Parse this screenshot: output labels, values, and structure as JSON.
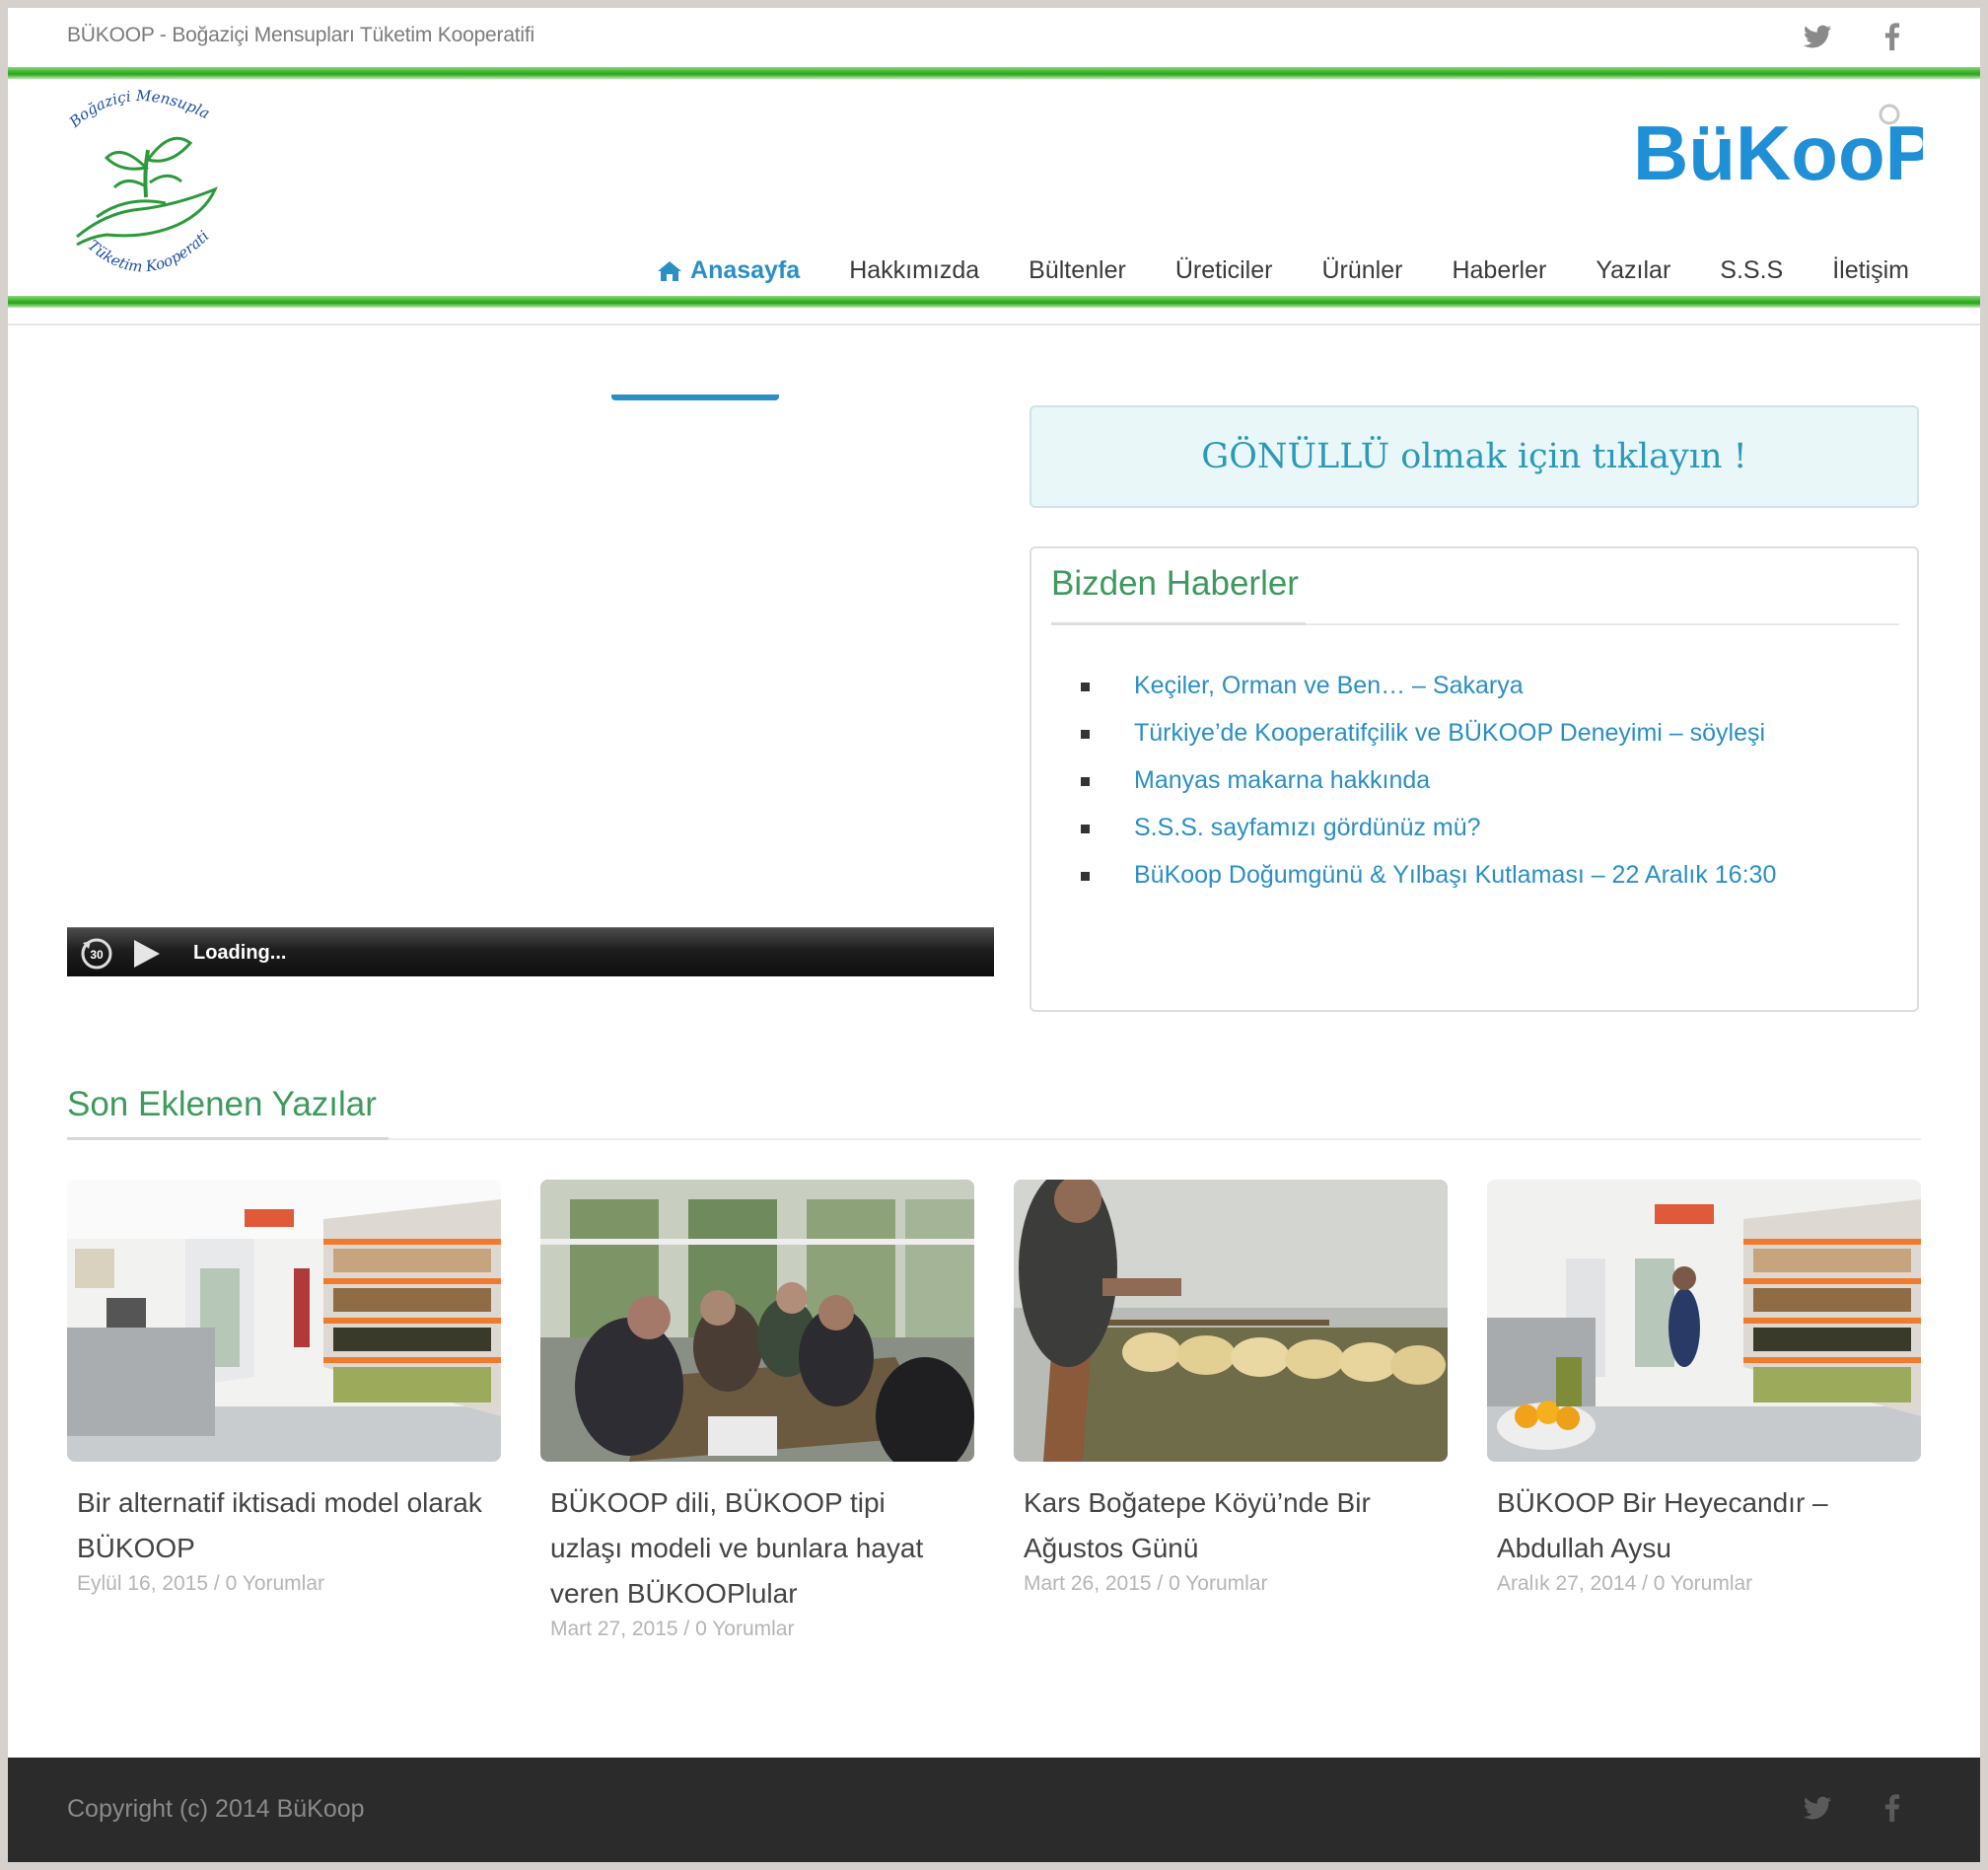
{
  "topbar": {
    "site_title": "BÜKOOP - Boğaziçi Mensupları Tüketim Kooperatifi",
    "social": [
      "twitter-icon",
      "facebook-icon"
    ]
  },
  "header": {
    "logo_text_top": "Boğaziçi Mensupları",
    "logo_text_bottom": "Tüketim Kooperatifi",
    "brand_text": "BüKooP",
    "brand_color": "#1f8fd6",
    "nav": [
      {
        "label": "Anasayfa",
        "active": true
      },
      {
        "label": "Hakkımızda"
      },
      {
        "label": "Bültenler"
      },
      {
        "label": "Üreticiler"
      },
      {
        "label": "Ürünler"
      },
      {
        "label": "Haberler"
      },
      {
        "label": "Yazılar"
      },
      {
        "label": "S.S.S"
      },
      {
        "label": "İletişim"
      }
    ]
  },
  "player": {
    "status": "Loading...",
    "rewind_label": "30"
  },
  "sidebar": {
    "volunteer_cta": "GÖNÜLLÜ olmak için tıklayın !",
    "news": {
      "title": "Bizden Haberler",
      "items": [
        "Keçiler, Orman ve Ben… – Sakarya",
        "Türkiye’de Kooperatifçilik ve BÜKOOP Deneyimi – söyleşi",
        "Manyas makarna hakkında",
        "S.S.S. sayfamızı gördünüz mü?",
        "BüKoop Doğumgünü & Yılbaşı Kutlaması – 22 Aralık 16:30"
      ]
    }
  },
  "recent": {
    "title": "Son Eklenen Yazılar",
    "posts": [
      {
        "title": "Bir alternatif iktisadi model olarak BÜKOOP",
        "meta": "Eylül 16, 2015 / 0 Yorumlar"
      },
      {
        "title": "BÜKOOP dili, BÜKOOP tipi uzlaşı modeli ve bunlara hayat veren BÜKOOPlular",
        "meta": "Mart 27, 2015 / 0 Yorumlar"
      },
      {
        "title": "Kars Boğatepe Köyü’nde Bir Ağustos Günü",
        "meta": "Mart 26, 2015 / 0 Yorumlar"
      },
      {
        "title": "BÜKOOP Bir Heyecandır – Abdullah Aysu",
        "meta": "Aralık 27, 2014 / 0 Yorumlar"
      }
    ]
  },
  "footer": {
    "copyright": "Copyright (c) 2014 BüKoop"
  },
  "colors": {
    "accent_green": "#3e9a5c",
    "link_blue": "#2a8fc4",
    "bar_green": "#2aa51a"
  }
}
